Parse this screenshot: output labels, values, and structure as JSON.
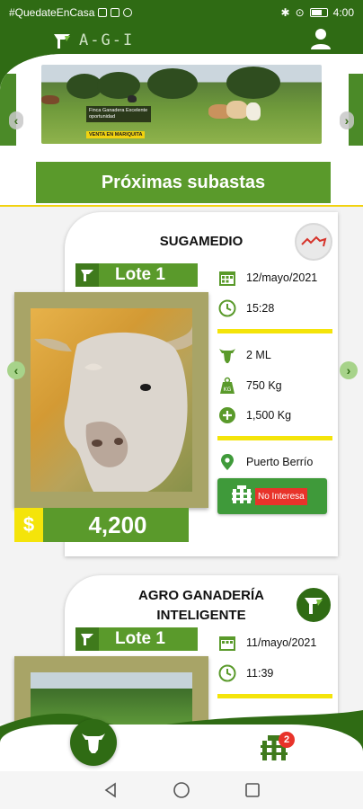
{
  "status_bar": {
    "hashtag": "#QuedateEnCasa",
    "time": "4:00",
    "battery_level": 0.7
  },
  "app": {
    "logo_text": "A-G-I",
    "header_color": "#2f6b14",
    "accent_yellow": "#f4e40a",
    "accent_green": "#5a9a2b"
  },
  "banner": {
    "caption": "Finca Ganadera Excelente oportunidad",
    "tag": "VENTA EN MARIQUITA"
  },
  "section": {
    "title": "Próximas subastas"
  },
  "auctions": [
    {
      "organizer": "SUGAMEDIO",
      "lote": "Lote 1",
      "date": "12/mayo/2021",
      "time": "15:28",
      "count": "2 ML",
      "weight": "750  Kg",
      "extra_weight": "1,500  Kg",
      "location": "Puerto Berrío",
      "action_label": "No Interesa",
      "currency": "$",
      "price": "4,200"
    },
    {
      "organizer": "AGRO GANADERÍA INTELIGENTE",
      "lote": "Lote 1",
      "date": "11/mayo/2021",
      "time": "11:39"
    }
  ],
  "bottom_nav": {
    "notification_count": "2"
  },
  "icons": {
    "user": "user-icon",
    "calendar": "calendar-icon",
    "clock": "clock-icon",
    "cattle": "cattle-icon",
    "weight": "weight-icon",
    "plus": "plus-circle-icon",
    "location": "location-pin-icon",
    "fence": "fence-icon"
  }
}
